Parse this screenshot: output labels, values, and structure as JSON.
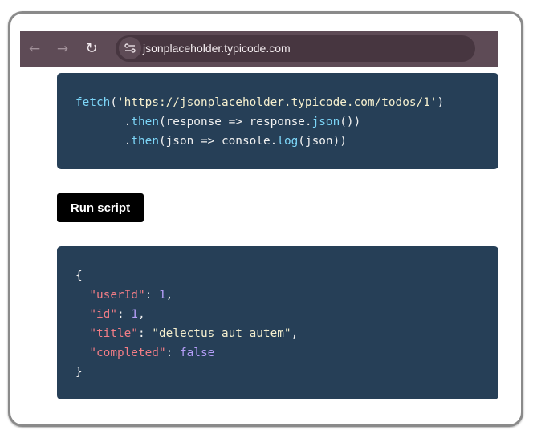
{
  "browser": {
    "url": "jsonplaceholder.typicode.com"
  },
  "request_code": {
    "fetch_fn": "fetch",
    "open_paren": "(",
    "url_literal": "'https://jsonplaceholder.typicode.com/todos/1'",
    "close_paren": ")",
    "then_1_prefix": ".",
    "then_1_fn": "then",
    "then_1_arg": "(response => response.",
    "then_1_json_fn": "json",
    "then_1_end": "())",
    "then_2_prefix": ".",
    "then_2_fn": "then",
    "then_2_arg": "(json => console.",
    "then_2_log_fn": "log",
    "then_2_end": "(json))"
  },
  "run_button": {
    "label": "Run script"
  },
  "response_json": {
    "open_brace": "{",
    "close_brace": "}",
    "fields": [
      {
        "key": "\"userId\"",
        "sep": ": ",
        "value": "1",
        "trail": ","
      },
      {
        "key": "\"id\"",
        "sep": ": ",
        "value": "1",
        "trail": ","
      },
      {
        "key": "\"title\"",
        "sep": ": ",
        "value": "\"delectus aut autem\"",
        "trail": ","
      },
      {
        "key": "\"completed\"",
        "sep": ": ",
        "value": "false",
        "trail": ""
      }
    ]
  }
}
